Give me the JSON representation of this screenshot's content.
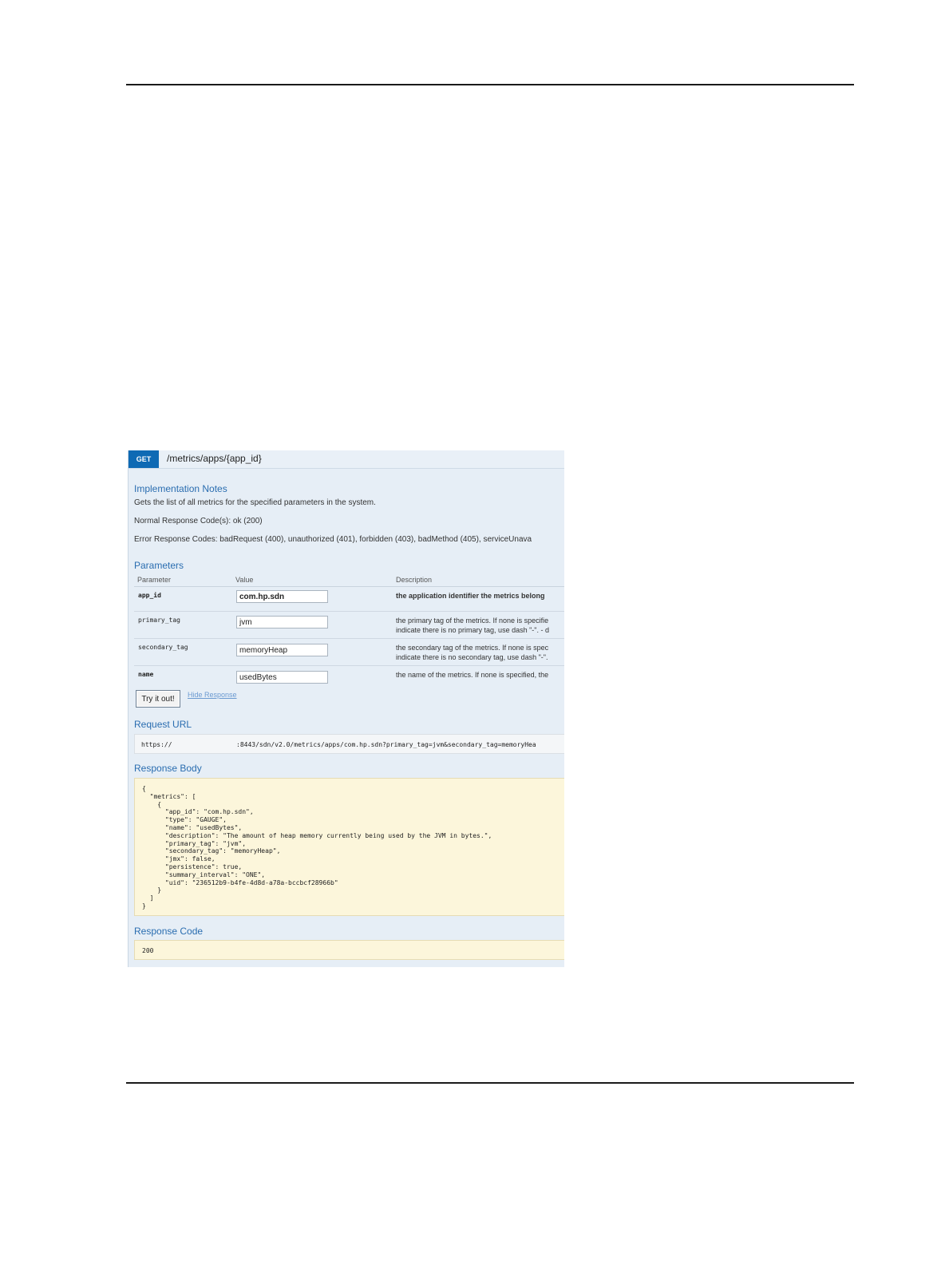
{
  "operation": {
    "method": "GET",
    "path": "/metrics/apps/{app_id}"
  },
  "implementation_notes": {
    "title": "Implementation Notes",
    "description": "Gets the list of all metrics for the specified parameters in the system.",
    "normal_codes": "Normal Response Code(s): ok (200)",
    "error_codes": "Error Response Codes: badRequest (400), unauthorized (401), forbidden (403), badMethod (405), serviceUnava"
  },
  "parameters": {
    "title": "Parameters",
    "columns": [
      "Parameter",
      "Value",
      "Description"
    ],
    "rows": [
      {
        "name": "app_id",
        "value": "com.hp.sdn",
        "desc1": "the application identifier the metrics belong",
        "desc2": ""
      },
      {
        "name": "primary_tag",
        "value": "jvm",
        "desc1": "the primary tag of the metrics. If none is specifie",
        "desc2": "indicate there is no primary tag, use dash \"-\". - d"
      },
      {
        "name": "secondary_tag",
        "value": "memoryHeap",
        "desc1": "the secondary tag of the metrics. If none is spec",
        "desc2": "indicate there is no secondary tag, use dash \"-\"."
      },
      {
        "name": "name",
        "value": "usedBytes",
        "desc1": "the name of the metrics. If none is specified, the",
        "desc2": ""
      }
    ]
  },
  "actions": {
    "try_label": "Try it out!",
    "hide_label": "Hide Response"
  },
  "request_url": {
    "title": "Request URL",
    "scheme": "https://",
    "rest": ":8443/sdn/v2.0/metrics/apps/com.hp.sdn?primary_tag=jvm&secondary_tag=memoryHea"
  },
  "response_body": {
    "title": "Response Body",
    "text": "{\n  \"metrics\": [\n    {\n      \"app_id\": \"com.hp.sdn\",\n      \"type\": \"GAUGE\",\n      \"name\": \"usedBytes\",\n      \"description\": \"The amount of heap memory currently being used by the JVM in bytes.\",\n      \"primary_tag\": \"jvm\",\n      \"secondary_tag\": \"memoryHeap\",\n      \"jmx\": false,\n      \"persistence\": true,\n      \"summary_interval\": \"ONE\",\n      \"uid\": \"236512b9-b4fe-4d8d-a78a-bccbcf28966b\"\n    }\n  ]\n}"
  },
  "response_code": {
    "title": "Response Code",
    "value": "200"
  }
}
